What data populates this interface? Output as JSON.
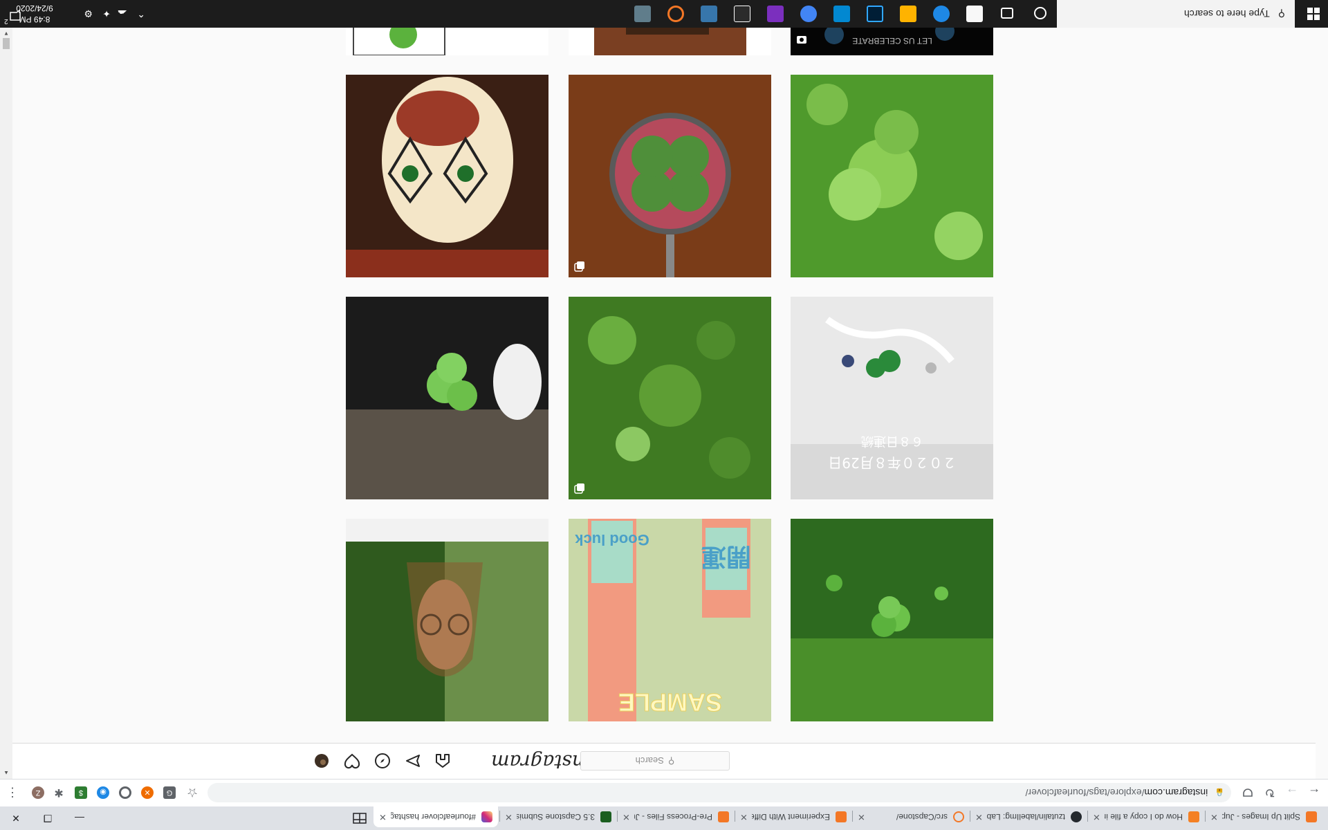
{
  "browser": {
    "tabs": [
      {
        "title": "Split Up Images - Jupyter N",
        "color": "#f37726"
      },
      {
        "title": "How do I copy a file in Pyth",
        "color": "#f48024"
      },
      {
        "title": "tzutalin/labelImg: Label",
        "color": "#24292e"
      },
      {
        "title": "src/Capstone/",
        "color": "#f37726"
      },
      {
        "title": "Experiment With Different",
        "color": "#f37726"
      },
      {
        "title": "Pre-Process Files - Jupyter",
        "color": "#f37726"
      },
      {
        "title": "3.5 Capstone Submission",
        "color": "#1b5e20"
      },
      {
        "title": "#fourleafclover hashtag on",
        "color": "#d6249f"
      }
    ],
    "url_host": "instagram.com",
    "url_path": "/explore/tags/fourleafclover/"
  },
  "instagram": {
    "logo": "Instagram",
    "search_placeholder": "Search"
  },
  "grid": {
    "tiles": [
      {
        "caption": ""
      },
      {
        "caption": ""
      },
      {
        "caption": "LET US CELEBRATE"
      },
      {
        "caption": ""
      },
      {
        "caption": ""
      },
      {
        "caption": ""
      },
      {
        "caption": ""
      },
      {
        "caption": ""
      },
      {
        "caption": "２０２０年８月29日"
      },
      {
        "caption": "SAMPLE"
      },
      {
        "caption": ""
      },
      {
        "caption": ""
      }
    ],
    "tile_2_extra": "６８日連続",
    "tile_1_extra": "Good luck",
    "tile_1_kanji": "開運"
  },
  "taskbar": {
    "search_placeholder": "Type here to search",
    "time": "8:49 PM",
    "date": "9/24/2020",
    "notification_count": "2"
  },
  "icons": [
    "back-arrow-icon",
    "forward-arrow-icon",
    "reload-icon",
    "pocket-icon",
    "lock-icon",
    "star-icon",
    "home-icon",
    "send-icon",
    "explore-icon",
    "heart-icon",
    "search-icon"
  ]
}
